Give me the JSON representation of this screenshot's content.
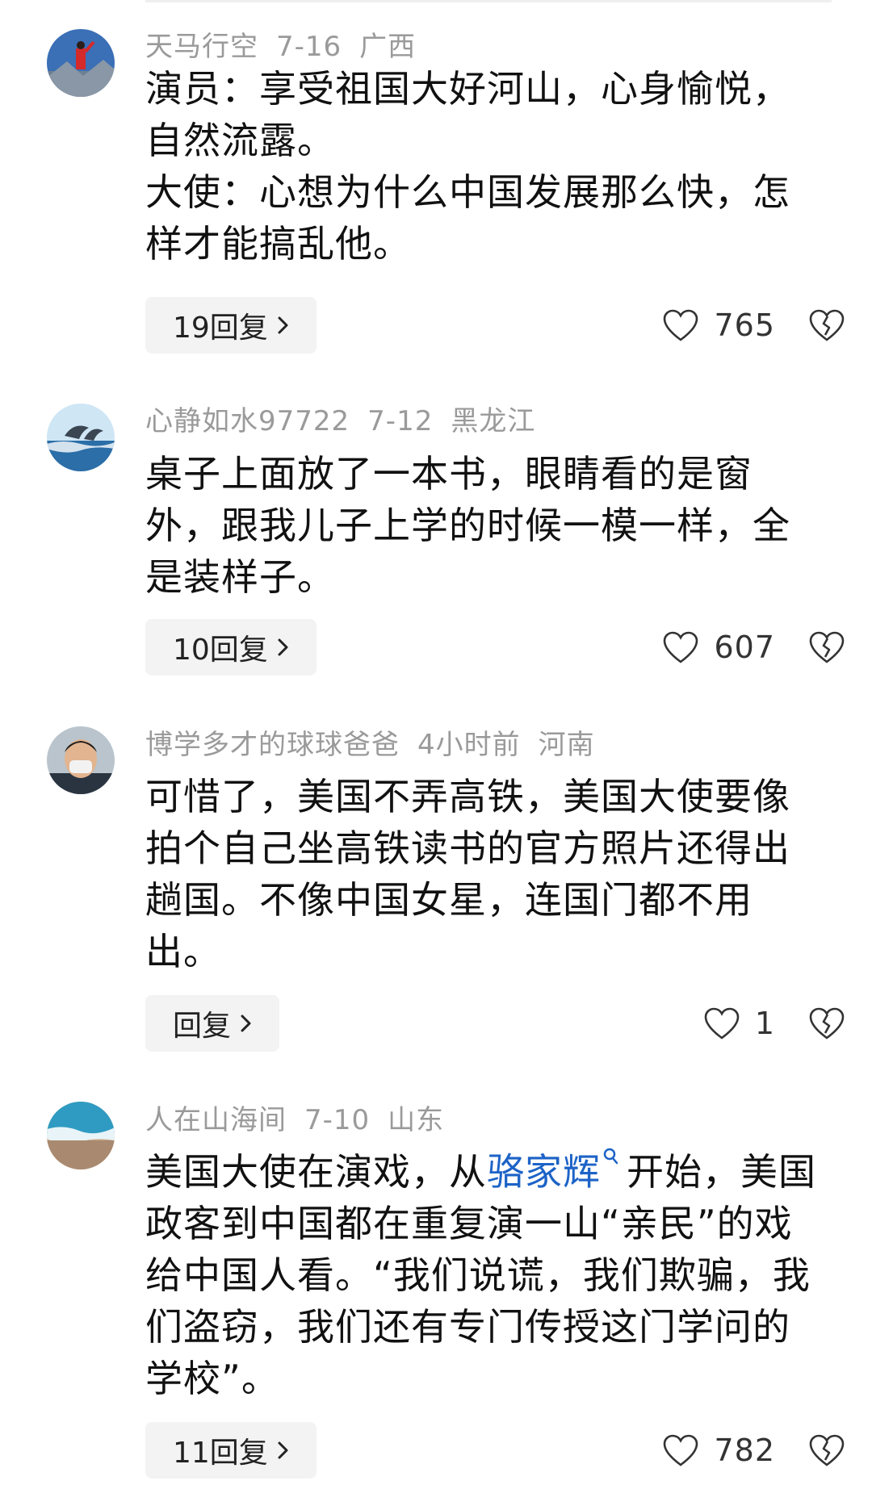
{
  "comments": [
    {
      "username": "天马行空",
      "date": "7-16",
      "location": "广西",
      "paragraphs": [
        "演员：享受祖国大好河山，心身愉悦，自然流露。",
        "大使：心想为什么中国发展那么快，怎样才能搞乱他。"
      ],
      "reply_label": "19回复",
      "likes": "765"
    },
    {
      "username": "心静如水97722",
      "date": "7-12",
      "location": "黑龙江",
      "paragraphs": [
        "桌子上面放了一本书，眼睛看的是窗外，跟我儿子上学的时候一模一样，全是装样子。"
      ],
      "reply_label": "10回复",
      "likes": "607"
    },
    {
      "username": "博学多才的球球爸爸",
      "date": "4小时前",
      "location": "河南",
      "paragraphs": [
        "可惜了，美国不弄高铁，美国大使要像拍个自己坐高铁读书的官方照片还得出趟国。不像中国女星，连国门都不用出。"
      ],
      "reply_label": "回复",
      "likes": "1"
    },
    {
      "username": "人在山海间",
      "date": "7-10",
      "location": "山东",
      "text_before_link": "美国大使在演戏，从",
      "link_text": "骆家辉",
      "text_after_link": "开始，美国政客到中国都在重复演一山“亲民”的戏给中国人看。“我们说谎，我们欺骗，我们盗窃，我们还有专门传授这门学问的学校”。",
      "reply_label": "11回复",
      "likes": "782"
    }
  ],
  "icons": {
    "like": "heart-outline-icon",
    "dislike": "broken-heart-icon",
    "reply_chevron": "chevron-right-icon",
    "search": "search-icon"
  },
  "colors": {
    "link": "#1d63c7",
    "meta_text": "#9a9a9a",
    "reply_bg": "#f3f3f3"
  }
}
